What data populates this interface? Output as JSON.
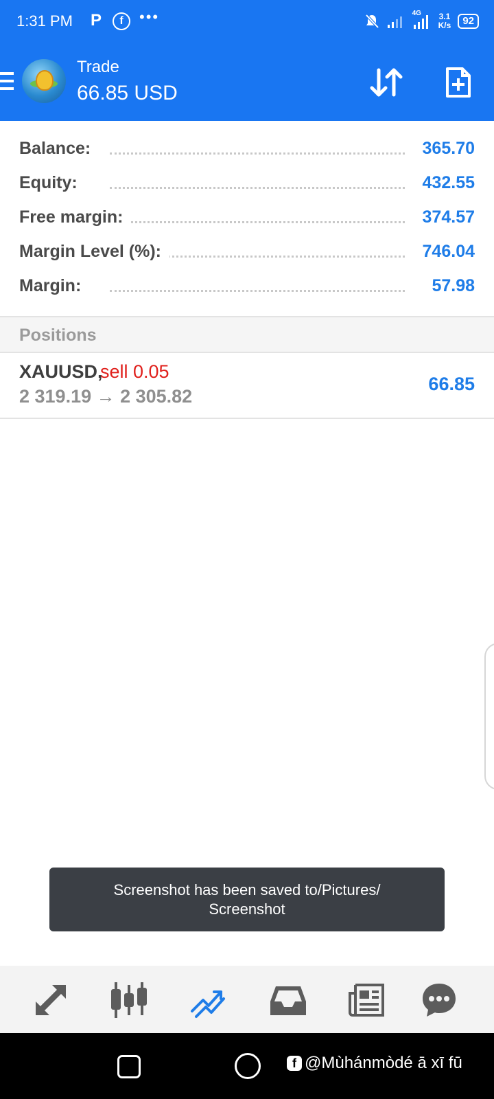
{
  "status_bar": {
    "time": "1:31 PM",
    "notification_letter": "P",
    "fb_letter": "f",
    "more_dots": "•••",
    "network_label": "4G",
    "speed_value": "3.1",
    "speed_unit": "K/s",
    "battery": "92"
  },
  "app_bar": {
    "title": "Trade",
    "subtitle": "66.85 USD"
  },
  "account": [
    {
      "label": "Balance:",
      "value": "365.70"
    },
    {
      "label": "Equity:",
      "value": "432.55"
    },
    {
      "label": "Free margin:",
      "value": "374.57"
    },
    {
      "label": "Margin Level (%):",
      "value": "746.04"
    },
    {
      "label": "Margin:",
      "value": "57.98"
    }
  ],
  "positions": {
    "header": "Positions",
    "items": [
      {
        "symbol": "XAUUSD,",
        "side": "sell 0.05",
        "prices": "2 319.19 → 2 305.82",
        "profit": "66.85"
      }
    ]
  },
  "toast": {
    "message": "Screenshot has been saved to/Pictures/ Screenshot"
  },
  "bottom_nav": [
    "quotes-icon",
    "chart-icon",
    "trade-icon",
    "history-icon",
    "news-icon",
    "chat-icon"
  ],
  "watermark": {
    "fb": "f",
    "text": "@Mùhánmòdé ā xī fū"
  },
  "colors": {
    "primary": "#1976f2",
    "value_blue": "#1f7de8",
    "sell_red": "#e0201c",
    "toast_bg": "#3b3f45"
  }
}
